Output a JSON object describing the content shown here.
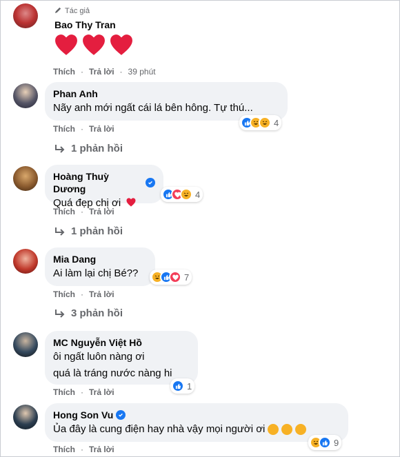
{
  "comments": [
    {
      "author_badge": "Tác giả",
      "name": "Bao Thy Tran",
      "actions": {
        "like": "Thích",
        "reply": "Trả lời",
        "time": "39 phút"
      },
      "hearts": 3
    },
    {
      "name": "Phan Anh",
      "text": "Nãy anh mới ngất cái lá bên hông. Tự thú...",
      "actions": {
        "like": "Thích",
        "reply": "Trả lời"
      },
      "reactions": [
        "like",
        "haha",
        "haha"
      ],
      "reaction_count": "4",
      "replies": "1 phản hồi"
    },
    {
      "name": "Hoàng Thuỳ Dương",
      "verified": true,
      "text": "Quá đẹp chị ơi",
      "actions": {
        "like": "Thích",
        "reply": "Trả lời"
      },
      "reactions": [
        "like",
        "love",
        "haha"
      ],
      "reaction_count": "4",
      "replies": "1 phản hồi"
    },
    {
      "name": "Mia Dang",
      "text": "Ai làm lại chị Bé??",
      "actions": {
        "like": "Thích",
        "reply": "Trả lời"
      },
      "reactions": [
        "haha",
        "like",
        "love"
      ],
      "reaction_count": "7",
      "replies": "3 phản hồi"
    },
    {
      "name": "MC Nguyễn Việt Hồ",
      "text_line1": "ôi ngất luôn nàng ơi",
      "text_line2": "quá là tráng nước nàng hi",
      "actions": {
        "like": "Thích",
        "reply": "Trả lời"
      },
      "reactions": [
        "like"
      ],
      "reaction_count": "1"
    },
    {
      "name": "Hong Son Vu",
      "verified": true,
      "text": "Ủa đây là cung điện hay nhà vậy mọi người ơi",
      "actions": {
        "like": "Thích",
        "reply": "Trả lời"
      },
      "reactions": [
        "haha",
        "like"
      ],
      "reaction_count": "9"
    }
  ],
  "colors": {
    "like": "#1877f2",
    "haha": "#f7b125",
    "love": "#f33e58",
    "heart": "#e41e3f",
    "meta": "#65676b",
    "bubble": "#f0f2f5"
  }
}
